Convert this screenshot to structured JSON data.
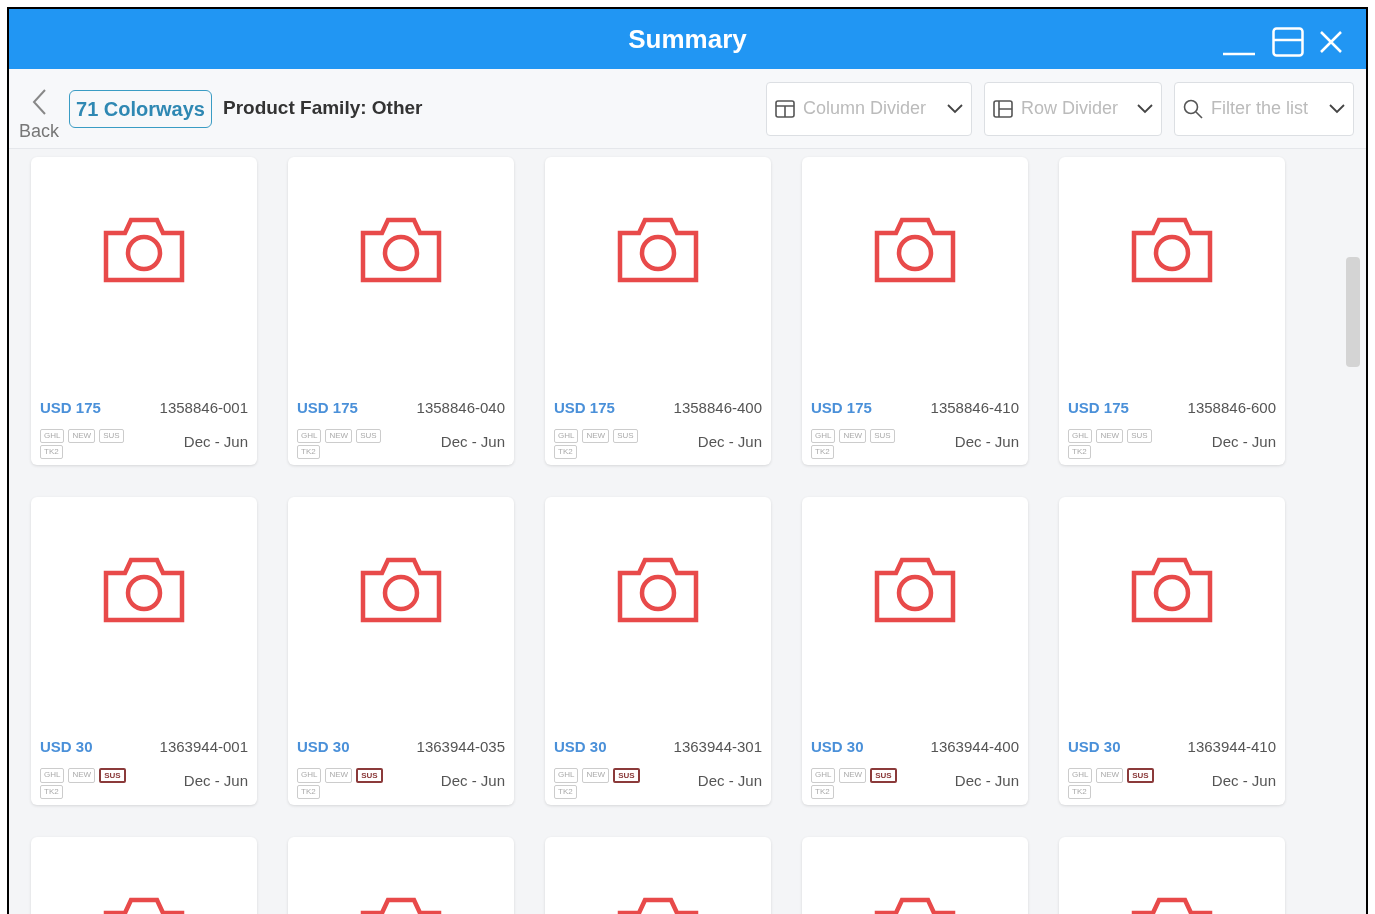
{
  "window": {
    "title": "Summary"
  },
  "toolbar": {
    "back_label": "Back",
    "count_badge": "71 Colorways",
    "heading": "Product Family: Other",
    "dropdowns": [
      {
        "kind": "column",
        "label": "Column Divider"
      },
      {
        "kind": "row",
        "label": "Row Divider"
      },
      {
        "kind": "search",
        "label": "Filter the list"
      }
    ]
  },
  "cards": [
    {
      "kind": "product",
      "price": "USD 175",
      "sku": "1358846-001",
      "season": "Dec - Jun",
      "tags": [
        {
          "label": "GHL",
          "active": false
        },
        {
          "label": "NEW",
          "active": false
        },
        {
          "label": "SUS",
          "active": false
        },
        {
          "label": "TK2",
          "active": false
        }
      ]
    },
    {
      "kind": "product",
      "price": "USD 175",
      "sku": "1358846-040",
      "season": "Dec - Jun",
      "tags": [
        {
          "label": "GHL",
          "active": false
        },
        {
          "label": "NEW",
          "active": false
        },
        {
          "label": "SUS",
          "active": false
        },
        {
          "label": "TK2",
          "active": false
        }
      ]
    },
    {
      "kind": "product",
      "price": "USD 175",
      "sku": "1358846-400",
      "season": "Dec - Jun",
      "tags": [
        {
          "label": "GHL",
          "active": false
        },
        {
          "label": "NEW",
          "active": false
        },
        {
          "label": "SUS",
          "active": false
        },
        {
          "label": "TK2",
          "active": false
        }
      ]
    },
    {
      "kind": "product",
      "price": "USD 175",
      "sku": "1358846-410",
      "season": "Dec - Jun",
      "tags": [
        {
          "label": "GHL",
          "active": false
        },
        {
          "label": "NEW",
          "active": false
        },
        {
          "label": "SUS",
          "active": false
        },
        {
          "label": "TK2",
          "active": false
        }
      ]
    },
    {
      "kind": "product",
      "price": "USD 175",
      "sku": "1358846-600",
      "season": "Dec - Jun",
      "tags": [
        {
          "label": "GHL",
          "active": false
        },
        {
          "label": "NEW",
          "active": false
        },
        {
          "label": "SUS",
          "active": false
        },
        {
          "label": "TK2",
          "active": false
        }
      ]
    },
    {
      "kind": "product",
      "price": "USD 30",
      "sku": "1363944-001",
      "season": "Dec - Jun",
      "tags": [
        {
          "label": "GHL",
          "active": false
        },
        {
          "label": "NEW",
          "active": false
        },
        {
          "label": "SUS",
          "active": true
        },
        {
          "label": "TK2",
          "active": false
        }
      ]
    },
    {
      "kind": "product",
      "price": "USD 30",
      "sku": "1363944-035",
      "season": "Dec - Jun",
      "tags": [
        {
          "label": "GHL",
          "active": false
        },
        {
          "label": "NEW",
          "active": false
        },
        {
          "label": "SUS",
          "active": true
        },
        {
          "label": "TK2",
          "active": false
        }
      ]
    },
    {
      "kind": "product",
      "price": "USD 30",
      "sku": "1363944-301",
      "season": "Dec - Jun",
      "tags": [
        {
          "label": "GHL",
          "active": false
        },
        {
          "label": "NEW",
          "active": false
        },
        {
          "label": "SUS",
          "active": true
        },
        {
          "label": "TK2",
          "active": false
        }
      ]
    },
    {
      "kind": "product",
      "price": "USD 30",
      "sku": "1363944-400",
      "season": "Dec - Jun",
      "tags": [
        {
          "label": "GHL",
          "active": false
        },
        {
          "label": "NEW",
          "active": false
        },
        {
          "label": "SUS",
          "active": true
        },
        {
          "label": "TK2",
          "active": false
        }
      ]
    },
    {
      "kind": "product",
      "price": "USD 30",
      "sku": "1363944-410",
      "season": "Dec - Jun",
      "tags": [
        {
          "label": "GHL",
          "active": false
        },
        {
          "label": "NEW",
          "active": false
        },
        {
          "label": "SUS",
          "active": true
        },
        {
          "label": "TK2",
          "active": false
        }
      ]
    },
    {
      "kind": "cut_off"
    },
    {
      "kind": "cut_off"
    },
    {
      "kind": "cut_off"
    },
    {
      "kind": "cut_off"
    },
    {
      "kind": "cut_off"
    }
  ]
}
